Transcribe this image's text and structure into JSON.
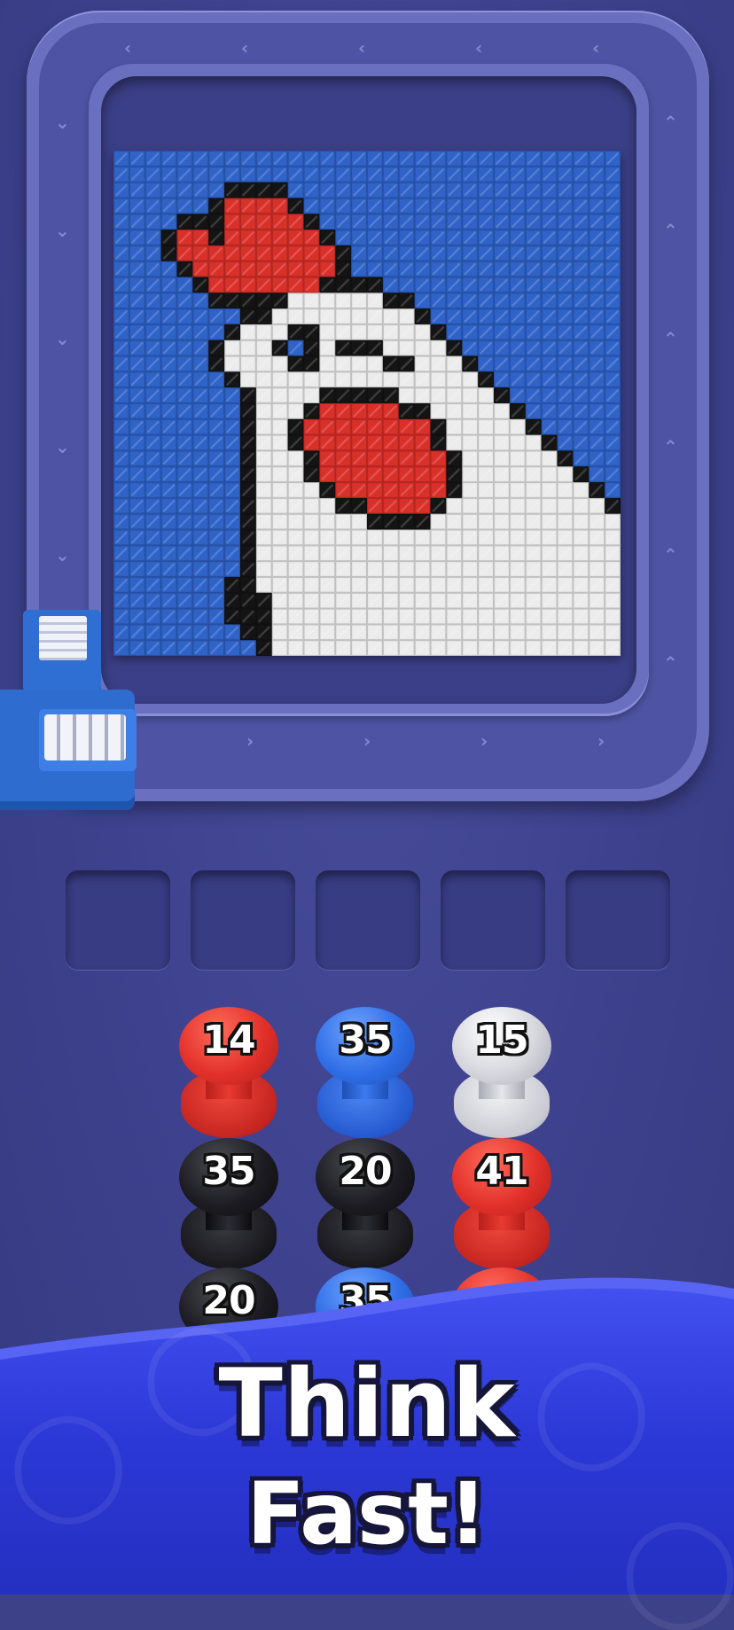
{
  "headline": {
    "line1": "Think",
    "line2": "Fast!"
  },
  "colors": {
    "background": "#3d4188",
    "track": "#6a6fc0",
    "canvas_blue": "#2f63c8",
    "red": "#d9302a",
    "white": "#ececec",
    "black": "#111111",
    "banner": "#2f3fe0"
  },
  "slots": {
    "count": 5,
    "filled": 0
  },
  "spools": [
    {
      "value": "14",
      "color": "red"
    },
    {
      "value": "35",
      "color": "blue"
    },
    {
      "value": "15",
      "color": "white"
    },
    {
      "value": "35",
      "color": "black"
    },
    {
      "value": "20",
      "color": "black"
    },
    {
      "value": "41",
      "color": "red"
    },
    {
      "value": "20",
      "color": "black"
    },
    {
      "value": "35",
      "color": "blue"
    },
    {
      "value": "",
      "color": "red"
    }
  ],
  "pixel_art": {
    "subject": "screaming chicken",
    "palette": {
      "B": "#2f63c8",
      "K": "#141414",
      "W": "#ececec",
      "R": "#d9302a"
    },
    "rows": [
      "BBBBBBBBBBBBBBBBBBBBBBBBBBBBBBBB",
      "BBBBBBBBBBBBBBBBBBBBBBBBBBBBBBBB",
      "BBBBBBBKKKKBBBBBBBBBBBBBBBBBBBBB",
      "BBBBBBKRRRRKBBBBBBBBBBBBBBBBBBBB",
      "BBBBKKKRRRRRKBBBBBBBBBBBBBBBBBBB",
      "BBBKRRKRRRRRRKBBBBBBBBBBBBBBBBBB",
      "BBBKRRRRRRRRRRKBBBBBBBBBBBBBBBBB",
      "BBBBKRRRRRRRRRKBBBBBBBBBBBBBBBBB",
      "BBBBBKRRRRRRRKKKKBBBBBBBBBBBBBBB",
      "BBBBBBKKKKKWWWWWWKKBBBBBBBBBBBBB",
      "BBBBBBBBKKWWWWWWWWWKBBBBBBBBBBBB",
      "BBBBBBBKWWWKKWWWWWWWKBBBBBBBBBBB",
      "BBBBBBKWWWKBKWKKKWWWWKBBBBBBBBBB",
      "BBBBBBKWWWWKKWWWWKKWWWKBBBBBBBBB",
      "BBBBBBBKWWWWWWWWWWWWWWWKBBBBBBBB",
      "BBBBBBBBKWWWWKKKKKWWWWWWKBBBBBBB",
      "BBBBBBBBKWWWKRRRRRKKWWWWWKBBBBBB",
      "BBBBBBBBKWWKRRRRRRRRKWWWWWKBBBBB",
      "BBBBBBBBKWWKRRRRRRRRKWWWWWWKBBBB",
      "BBBBBBBBKWWWKRRRRRRRRKWWWWWWKBBB",
      "BBBBBBBBKWWWKRRRRRRRRKWWWWWWWKBB",
      "BBBBBBBBKWWWWKRRRRRRRKWWWWWWWWKB",
      "BBBBBBBBKWWWWWKKRRRRKWWWWWWWWWWK",
      "BBBBBBBBKWWWWWWWKKKKWWWWWWWWWWWW",
      "BBBBBBBBKWWWWWWWWWWWWWWWWWWWWWWW",
      "BBBBBBBBKWWWWWWWWWWWWWWWWWWWWWWW",
      "BBBBBBBBKWWWWWWWWWWWWWWWWWWWWWWW",
      "BBBBBBBKKWWWWWWWWWWWWWWWWWWWWWWW",
      "BBBBBBBKKKWWWWWWWWWWWWWWWWWWWWWW",
      "BBBBBBBKKKWWWWWWWWWWWWWWWWWWWWWW",
      "BBBBBBBBKKWWWWWWWWWWWWWWWWWWWWWW",
      "BBBBBBBBBKWWWWWWWWWWWWWWWWWWWWWW"
    ]
  }
}
